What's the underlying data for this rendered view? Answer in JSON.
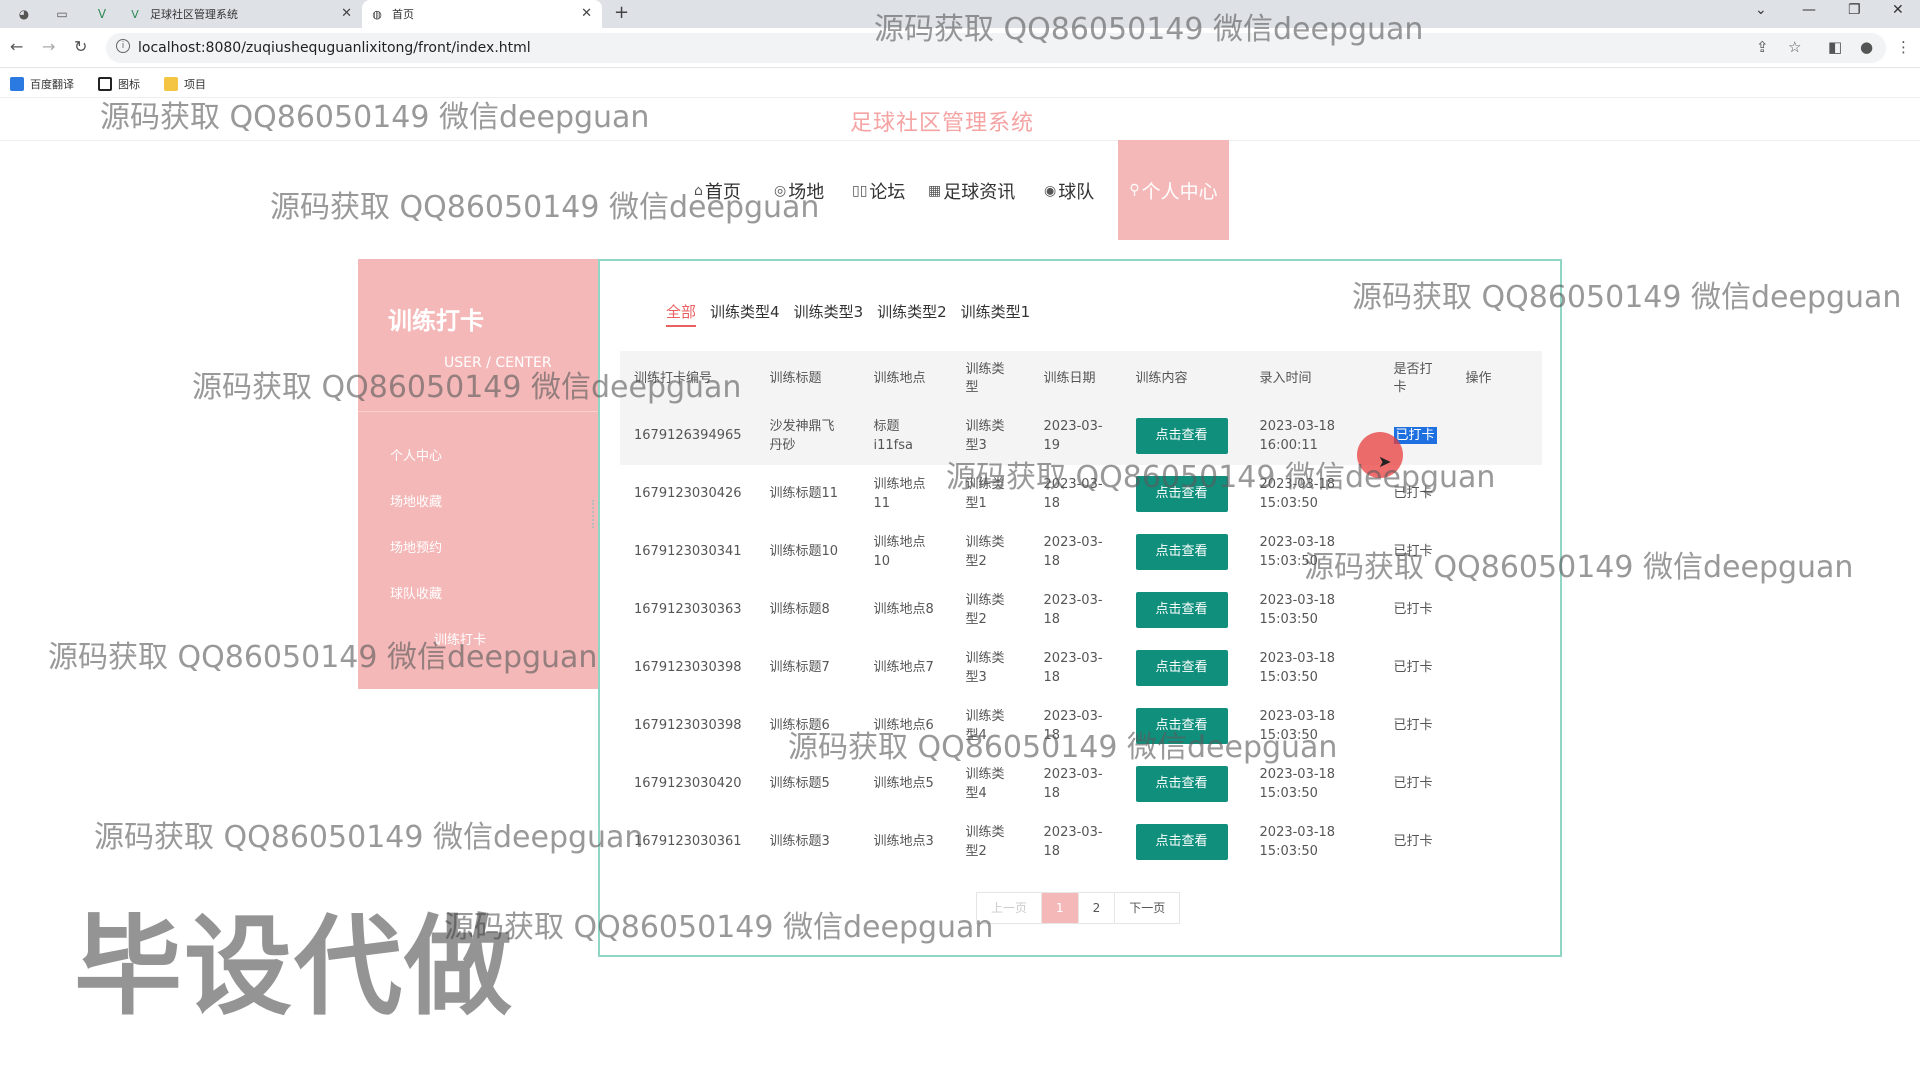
{
  "browser": {
    "tabs": [
      {
        "title": "足球社区管理系统"
      },
      {
        "title": "首页"
      }
    ],
    "url": "localhost:8080/zuqiushequguanlixitong/front/index.html",
    "bookmarks": [
      "百度翻译",
      "图标",
      "项目"
    ]
  },
  "header": {
    "site_title": "足球社区管理系统",
    "nav": [
      "首页",
      "场地",
      "论坛",
      "足球资讯",
      "球队"
    ],
    "nav_active": "个人中心"
  },
  "side": {
    "title": "训练打卡",
    "subtitle": "USER / CENTER",
    "items": [
      "个人中心",
      "场地收藏",
      "场地预约",
      "球队收藏",
      "训练打卡"
    ]
  },
  "filters": [
    "全部",
    "训练类型4",
    "训练类型3",
    "训练类型2",
    "训练类型1"
  ],
  "table": {
    "headers": [
      "训练打卡编号",
      "训练标题",
      "训练地点",
      "训练类型",
      "训练日期",
      "训练内容",
      "录入时间",
      "是否打卡",
      "操作"
    ],
    "view_label": "点击查看",
    "rows": [
      {
        "id": "1679126394965",
        "title": "沙发神鼎飞丹砂",
        "place": "标题i11fsa",
        "type": "训练类型3",
        "date": "2023-03-19",
        "time": "2023-03-18 16:00:11",
        "status": "已打卡"
      },
      {
        "id": "1679123030426",
        "title": "训练标题11",
        "place": "训练地点11",
        "type": "训练类型1",
        "date": "2023-03-18",
        "time": "2023-03-18 15:03:50",
        "status": "已打卡"
      },
      {
        "id": "1679123030341",
        "title": "训练标题10",
        "place": "训练地点10",
        "type": "训练类型2",
        "date": "2023-03-18",
        "time": "2023-03-18 15:03:50",
        "status": "已打卡"
      },
      {
        "id": "1679123030363",
        "title": "训练标题8",
        "place": "训练地点8",
        "type": "训练类型2",
        "date": "2023-03-18",
        "time": "2023-03-18 15:03:50",
        "status": "已打卡"
      },
      {
        "id": "1679123030398",
        "title": "训练标题7",
        "place": "训练地点7",
        "type": "训练类型3",
        "date": "2023-03-18",
        "time": "2023-03-18 15:03:50",
        "status": "已打卡"
      },
      {
        "id": "1679123030398",
        "title": "训练标题6",
        "place": "训练地点6",
        "type": "训练类型4",
        "date": "2023-03-18",
        "time": "2023-03-18 15:03:50",
        "status": "已打卡"
      },
      {
        "id": "1679123030420",
        "title": "训练标题5",
        "place": "训练地点5",
        "type": "训练类型4",
        "date": "2023-03-18",
        "time": "2023-03-18 15:03:50",
        "status": "已打卡"
      },
      {
        "id": "1679123030361",
        "title": "训练标题3",
        "place": "训练地点3",
        "type": "训练类型2",
        "date": "2023-03-18",
        "time": "2023-03-18 15:03:50",
        "status": "已打卡"
      }
    ]
  },
  "pager": {
    "prev": "上一页",
    "pages": [
      "1",
      "2"
    ],
    "current": "1",
    "next": "下一页"
  },
  "watermark": {
    "text": "源码获取 QQ86050149 微信deepguan",
    "big": "毕设代做"
  },
  "colors": {
    "accent_pink": "#f5b8b8",
    "title_pink": "#f5a3a3",
    "button_teal": "#108f7c",
    "panel_border": "#8fd6c5"
  }
}
